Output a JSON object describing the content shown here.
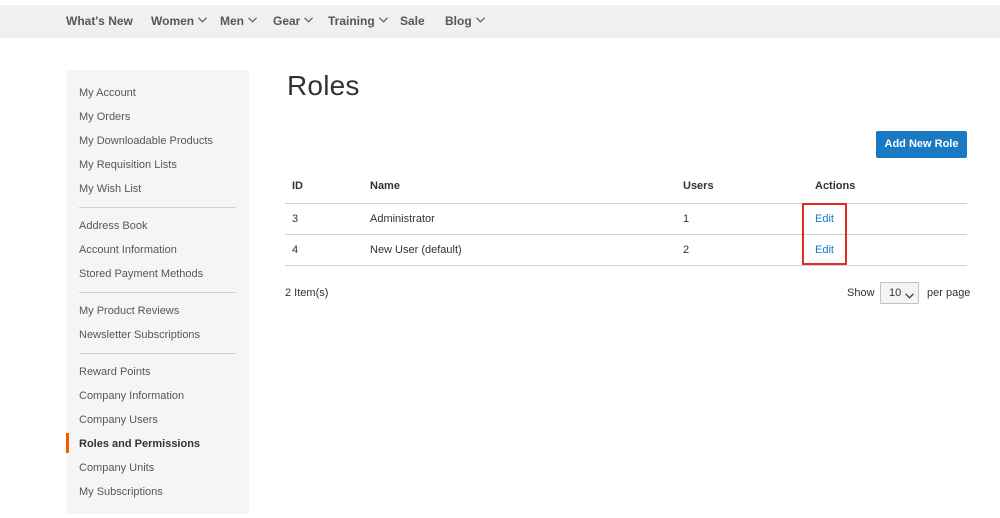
{
  "nav": {
    "items": [
      {
        "label": "What's New",
        "has_menu": false
      },
      {
        "label": "Women",
        "has_menu": true
      },
      {
        "label": "Men",
        "has_menu": true
      },
      {
        "label": "Gear",
        "has_menu": true
      },
      {
        "label": "Training",
        "has_menu": true
      },
      {
        "label": "Sale",
        "has_menu": false
      },
      {
        "label": "Blog",
        "has_menu": true
      }
    ]
  },
  "sidebar": {
    "groups": [
      [
        "My Account",
        "My Orders",
        "My Downloadable Products",
        "My Requisition Lists",
        "My Wish List"
      ],
      [
        "Address Book",
        "Account Information",
        "Stored Payment Methods"
      ],
      [
        "My Product Reviews",
        "Newsletter Subscriptions"
      ],
      [
        "Reward Points",
        "Company Information",
        "Company Users",
        "Roles and Permissions",
        "Company Units",
        "My Subscriptions"
      ]
    ],
    "active": "Roles and Permissions",
    "accent_color": "#ff5501"
  },
  "main": {
    "title": "Roles",
    "add_button_label": "Add New Role",
    "accent_color": "#1979c3",
    "table": {
      "headers": {
        "id": "ID",
        "name": "Name",
        "users": "Users",
        "actions": "Actions"
      },
      "rows": [
        {
          "id": "3",
          "name": "Administrator",
          "users": "1",
          "action": "Edit"
        },
        {
          "id": "4",
          "name": "New User (default)",
          "users": "2",
          "action": "Edit"
        }
      ]
    },
    "toolbar": {
      "item_count": "2 Item(s)",
      "show_label": "Show",
      "per_page_value": "10",
      "per_page_label": "per page"
    },
    "highlight_color": "#e02b27"
  }
}
